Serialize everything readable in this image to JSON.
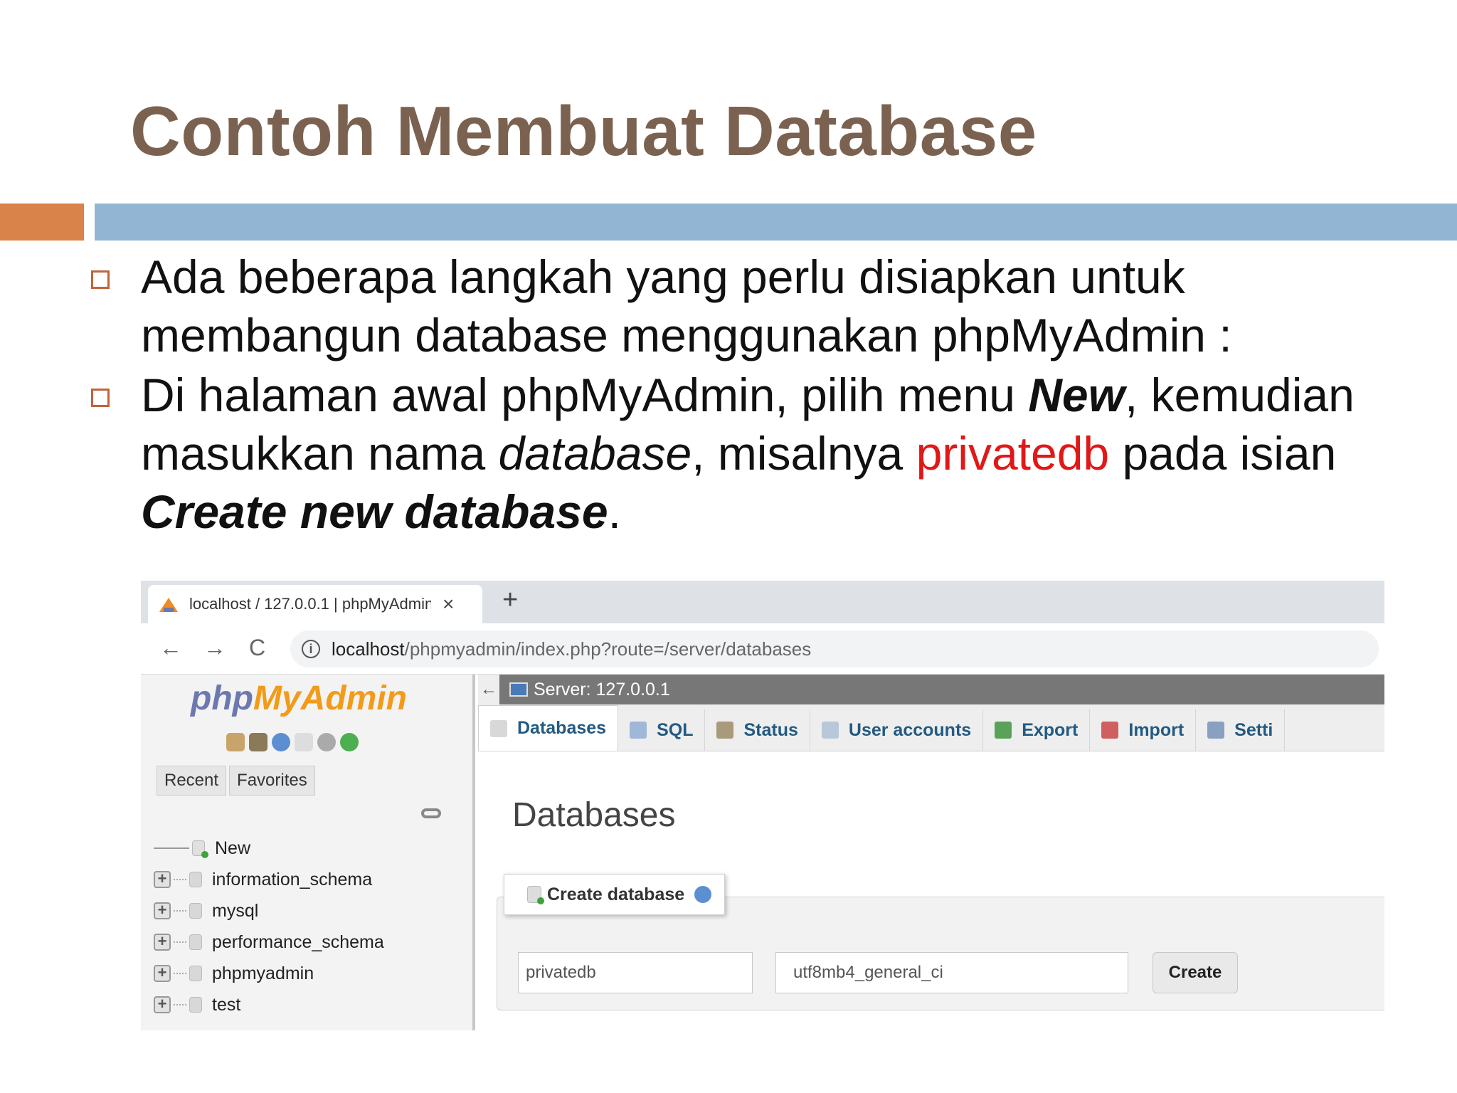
{
  "slide": {
    "title": "Contoh Membuat Database",
    "bullet1": "Ada beberapa langkah yang perlu disiapkan untuk membangun database menggunakan phpMyAdmin :",
    "bullet2": {
      "part1": "Di halaman awal phpMyAdmin, pilih menu ",
      "new_word": "New",
      "part2": ", kemudian masukkan nama ",
      "database_word": "database",
      "part3": ", misalnya ",
      "dbname": "privatedb",
      "part4": " pada isian ",
      "create_label": "Create new database",
      "part5": "."
    }
  },
  "browser": {
    "tab_title": "localhost / 127.0.0.1 | phpMyAdmin",
    "tab_close": "×",
    "new_tab": "+",
    "back": "←",
    "forward": "→",
    "reload": "C",
    "info": "i",
    "url_host": "localhost",
    "url_path": "/phpmyadmin/index.php?route=/server/databases"
  },
  "pma": {
    "logo_php": "php",
    "logo_myadmin": "MyAdmin",
    "recent": "Recent",
    "favorites": "Favorites",
    "tree": [
      {
        "label": "New"
      },
      {
        "label": "information_schema"
      },
      {
        "label": "mysql"
      },
      {
        "label": "performance_schema"
      },
      {
        "label": "phpmyadmin"
      },
      {
        "label": "test"
      }
    ],
    "expander": "+",
    "collapse_arrow": "←",
    "server_label": "Server: 127.0.0.1",
    "menu": [
      {
        "label": "Databases",
        "icon_color": "#d8d8d8"
      },
      {
        "label": "SQL",
        "icon_color": "#9fb8d8"
      },
      {
        "label": "Status",
        "icon_color": "#a89a7a"
      },
      {
        "label": "User accounts",
        "icon_color": "#b8c8d8"
      },
      {
        "label": "Export",
        "icon_color": "#5aa25a"
      },
      {
        "label": "Import",
        "icon_color": "#d06060"
      },
      {
        "label": "Setti",
        "icon_color": "#8aa0c0"
      }
    ],
    "heading": "Databases",
    "create_legend": "Create database",
    "db_name_value": "privatedb",
    "collation_value": "utf8mb4_general_ci",
    "create_button": "Create"
  },
  "colors": {
    "title": "#7b6250",
    "bar_orange": "#d9824a",
    "bar_blue": "#93b5d4",
    "highlight_red": "#e01818",
    "pma_link": "#235a81"
  }
}
